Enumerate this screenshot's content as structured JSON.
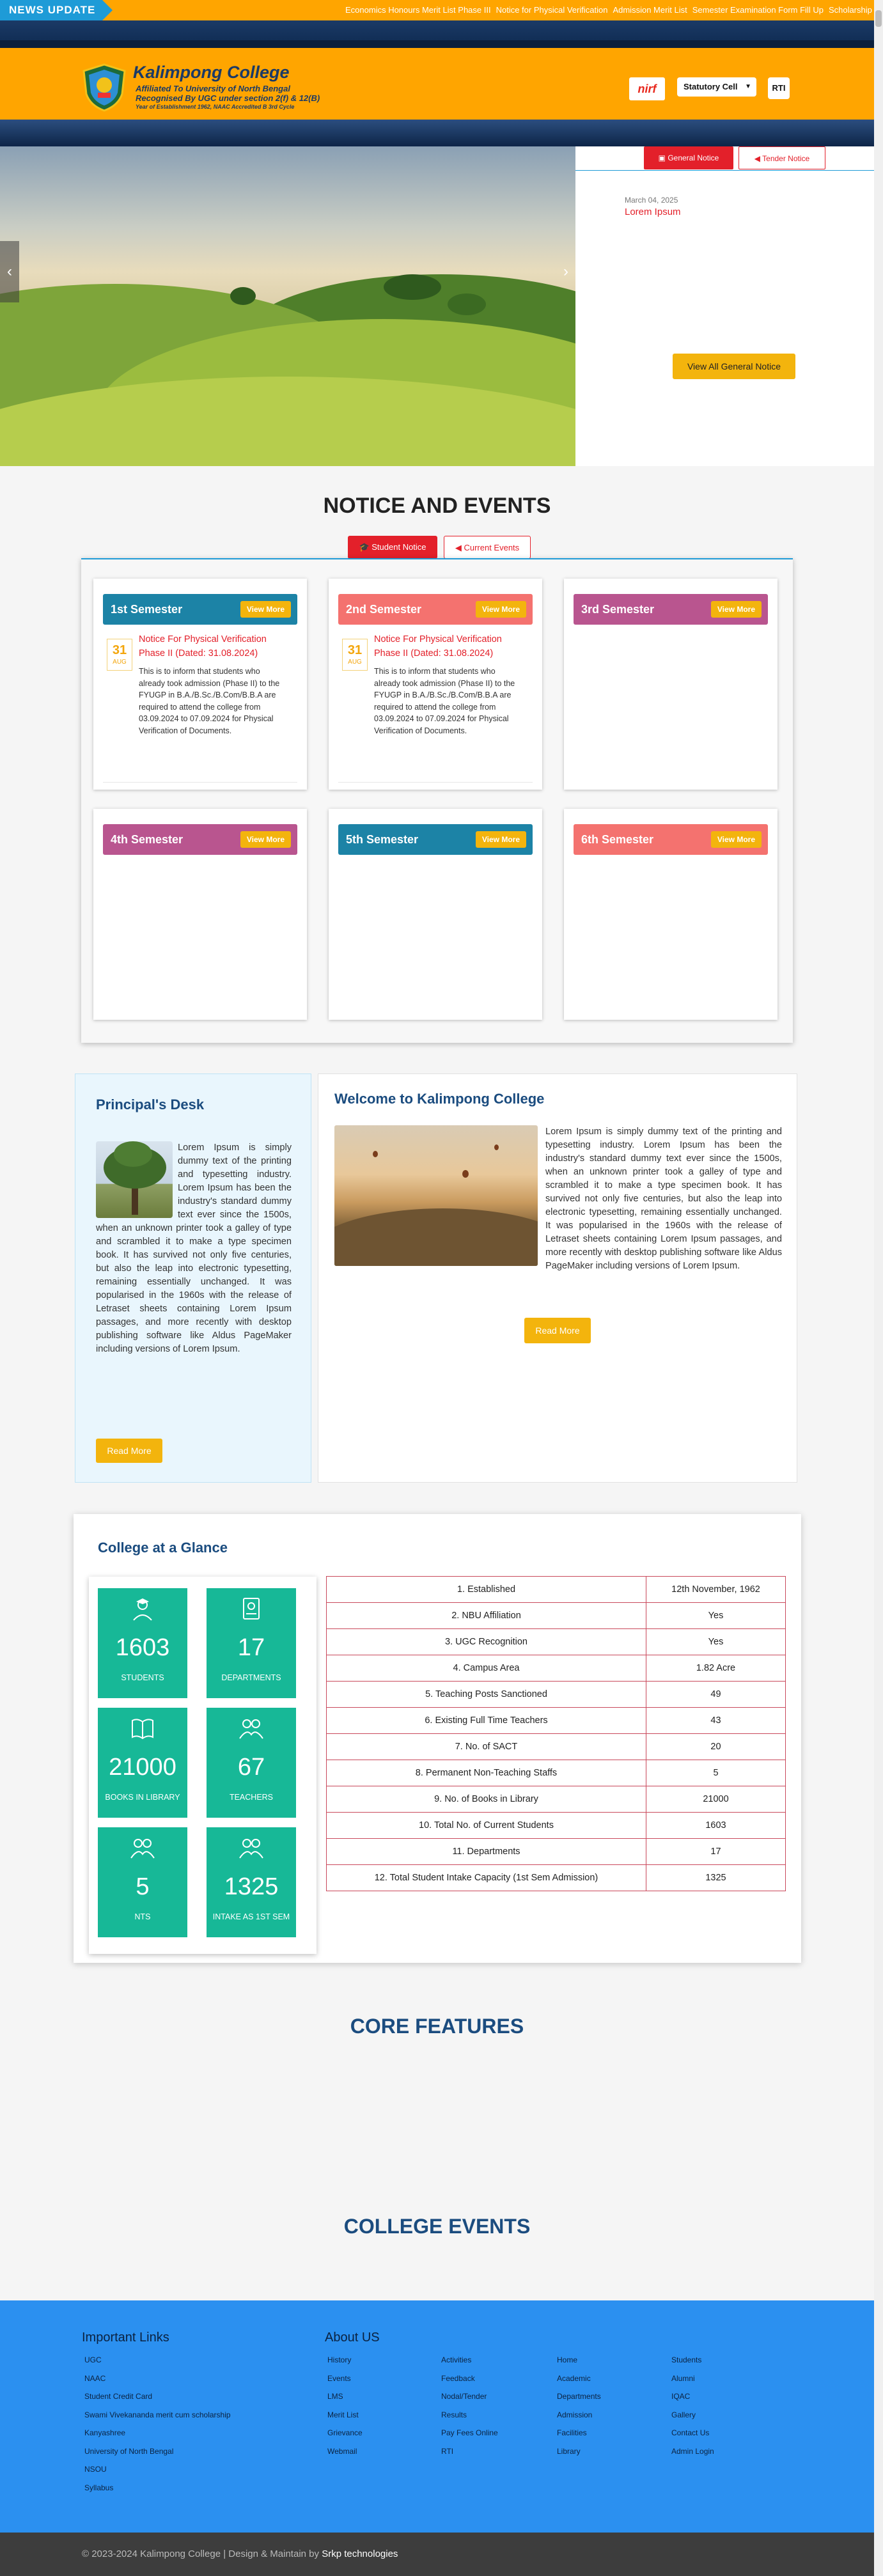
{
  "news": {
    "label": "NEWS UPDATE",
    "items": [
      "Economics Honours Merit List Phase III",
      "Notice for Physical Verification",
      "Admission Merit List",
      "Semester Examination Form Fill Up",
      "Scholarship Notice"
    ]
  },
  "header": {
    "college_name": "Kalimpong College",
    "line1": "Affiliated To University of North Bengal",
    "line2": "Recognised By UGC under section 2(f) & 12(B)",
    "line3": "Year of Establishment 1962, NAAC Accredited B 3rd Cycle",
    "nirf_label": "nirf",
    "statutory_label": "Statutory Cell",
    "rti_label": "RTI"
  },
  "notice_panel": {
    "tab_general": "General Notice",
    "tab_tender": "Tender Notice",
    "date": "March 04, 2025",
    "title": "Lorem Ipsum",
    "view_all": "View All General Notice"
  },
  "notice_events": {
    "title": "NOTICE AND EVENTS",
    "tab_student": "Student Notice",
    "tab_events": "Current Events",
    "view_more": "View More",
    "semesters": [
      {
        "name": "1st Semester",
        "color": "#1c83a6",
        "has_notice": true
      },
      {
        "name": "2nd Semester",
        "color": "#f4726f",
        "has_notice": true
      },
      {
        "name": "3rd Semester",
        "color": "#b9558f",
        "has_notice": false
      },
      {
        "name": "4th Semester",
        "color": "#b9558f",
        "has_notice": false
      },
      {
        "name": "5th Semester",
        "color": "#1c83a6",
        "has_notice": false
      },
      {
        "name": "6th Semester",
        "color": "#f4726f",
        "has_notice": false
      }
    ],
    "notice": {
      "day": "31",
      "month": "AUG",
      "title": "Notice For Physical Verification Phase II (Dated: 31.08.2024)",
      "body": "This is to inform that students who already took admission (Phase II) to the FYUGP in B.A./B.Sc./B.Com/B.B.A are required to attend the college from 03.09.2024 to 07.09.2024 for Physical Verification of Documents."
    }
  },
  "principal": {
    "title": "Principal's Desk",
    "text": "Lorem Ipsum is simply dummy text of the printing and typesetting industry. Lorem Ipsum has been the industry's standard dummy text ever since the 1500s, when an unknown printer took a galley of type and scrambled it to make a type specimen book. It has survived not only five centuries, but also the leap into electronic typesetting, remaining essentially unchanged. It was popularised in the 1960s with the release of Letraset sheets containing Lorem Ipsum passages, and more recently with desktop publishing software like Aldus PageMaker including versions of Lorem Ipsum.",
    "button": "Read More"
  },
  "welcome": {
    "title": "Welcome to Kalimpong College",
    "text": "Lorem Ipsum is simply dummy text of the printing and typesetting industry. Lorem Ipsum has been the industry's standard dummy text ever since the 1500s, when an unknown printer took a galley of type and scrambled it to make a type specimen book. It has survived not only five centuries, but also the leap into electronic typesetting, remaining essentially unchanged. It was popularised in the 1960s with the release of Letraset sheets containing Lorem Ipsum passages, and more recently with desktop publishing software like Aldus PageMaker including versions of Lorem Ipsum.",
    "button": "Read More"
  },
  "glance": {
    "title": "College at a Glance",
    "stats": [
      {
        "value": "1603",
        "label": "STUDENTS",
        "icon": "student-icon"
      },
      {
        "value": "17",
        "label": "DEPARTMENTS",
        "icon": "departments-icon"
      },
      {
        "value": "21000",
        "label": "BOOKS IN LIBRARY",
        "icon": "book-icon"
      },
      {
        "value": "67",
        "label": "TEACHERS",
        "icon": "teachers-icon"
      },
      {
        "value": "5",
        "label": "NTS",
        "icon": "staff-icon"
      },
      {
        "value": "1325",
        "label": "INTAKE AS 1ST SEM",
        "icon": "intake-icon"
      }
    ],
    "table": [
      [
        "1. Established",
        "12th November, 1962"
      ],
      [
        "2. NBU Affiliation",
        "Yes"
      ],
      [
        "3. UGC Recognition",
        "Yes"
      ],
      [
        "4. Campus Area",
        "1.82 Acre"
      ],
      [
        "5. Teaching Posts Sanctioned",
        "49"
      ],
      [
        "6. Existing Full Time Teachers",
        "43"
      ],
      [
        "7. No. of SACT",
        "20"
      ],
      [
        "8. Permanent Non-Teaching Staffs",
        "5"
      ],
      [
        "9. No. of Books in Library",
        "21000"
      ],
      [
        "10. Total No. of Current Students",
        "1603"
      ],
      [
        "11. Departments",
        "17"
      ],
      [
        "12. Total Student Intake Capacity (1st Sem Admission)",
        "1325"
      ]
    ]
  },
  "core_features": {
    "title": "CORE FEATURES"
  },
  "college_events": {
    "title": "COLLEGE EVENTS"
  },
  "footer": {
    "important_links_title": "Important Links",
    "important_links": [
      "UGC",
      "NAAC",
      "Student Credit Card",
      "Swami Vivekananda merit cum scholarship",
      "Kanyashree",
      "University of North Bengal",
      "NSOU",
      "Syllabus"
    ],
    "about_title": "About US",
    "about_cols": [
      [
        "History",
        "Events",
        "LMS",
        "Merit List",
        "Grievance",
        "Webmail"
      ],
      [
        "Activities",
        "Feedback",
        "Nodal/Tender",
        "Results",
        "Pay Fees Online",
        "RTI"
      ],
      [
        "Home",
        "Academic",
        "Departments",
        "Admission",
        "Facilities",
        "Library"
      ],
      [
        "Students",
        "Alumni",
        "IQAC",
        "Gallery",
        "Contact Us",
        "Admin Login"
      ]
    ],
    "copyright": "© 2023-2024 Kalimpong College | Design & Maintain by",
    "maker": "Srkp technologies"
  }
}
